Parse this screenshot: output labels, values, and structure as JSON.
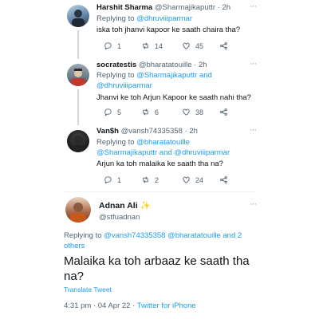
{
  "replies": [
    {
      "name": "Harshit Sharma",
      "handle": "@Sharmajikaputtr",
      "time": "· 2h",
      "replying_prefix": "Replying to",
      "replying_to": "@dhruviiiparmar",
      "replying_to_2": "",
      "text": "iska toh jhanvi kapoor ke saath chaira tha?",
      "replies": "1",
      "retweets": "14",
      "likes": "45"
    },
    {
      "name": "socratestis",
      "handle": "@bharatatouille",
      "time": "· 2h",
      "replying_prefix": "Replying to",
      "replying_to": "@Sharmajikaputtr and",
      "replying_to_2": "@dhruviiiparmar",
      "text": "Jhanvi ke toh Arjun Kapoor ke saath nahi tha?",
      "replies": "5",
      "retweets": "6",
      "likes": "38"
    },
    {
      "name": "Van$h",
      "handle": "@vansh74335358",
      "time": "· 2h",
      "replying_prefix": "Replying to",
      "replying_to": "@bharatatouille",
      "replying_to_2": "@Sharmajikaputtr and @dhruviiiparmar",
      "text": "Arjun ka toh malaika ke saath tha na?",
      "replies": "1",
      "retweets": "2",
      "likes": "24"
    }
  ],
  "main": {
    "name": "Adnan Ali",
    "name_emoji": "✨",
    "handle": "@stfuadnan",
    "replying_prefix": "Replying to",
    "replying_to": "@vansh74335358 @bharatatouille and 2 others",
    "text": "Malaika ka toh arbaaz ke saath tha na?",
    "translate": "Translate Tweet",
    "timestamp": "4:31 pm · 04 Apr 22 ·",
    "source": "Twitter for iPhone"
  },
  "icons": {
    "reply": "reply-icon",
    "retweet": "retweet-icon",
    "like": "heart-icon",
    "share": "share-icon",
    "more": "more-icon"
  },
  "colors": {
    "link": "#1d9bf0",
    "muted": "#536471",
    "text": "#0f1419",
    "thread_line": "#cfd9de"
  }
}
